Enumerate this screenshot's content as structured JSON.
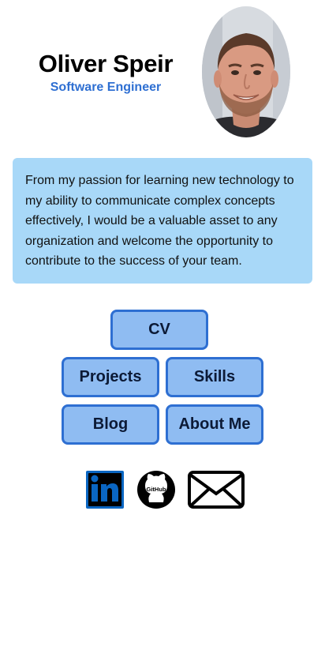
{
  "profile": {
    "name": "Oliver Speir",
    "role": "Software Engineer"
  },
  "about": {
    "text": "From my passion for learning new technology to my ability to communicate complex concepts effectively, I would be a valuable asset to any organization and welcome the opportunity to contribute to the success of your team."
  },
  "nav": {
    "cv": "CV",
    "projects": "Projects",
    "skills": "Skills",
    "blog": "Blog",
    "about_me": "About Me"
  },
  "social": {
    "linkedin_icon": "linkedin-icon",
    "github_icon": "github-icon",
    "github_wordmark": "GitHub",
    "email_icon": "mail-icon"
  },
  "colors": {
    "accent": "#2e6fd2",
    "button_fill": "#8fbcf2",
    "about_bg": "#a8d8f8",
    "linkedin": "#0a66c2"
  }
}
